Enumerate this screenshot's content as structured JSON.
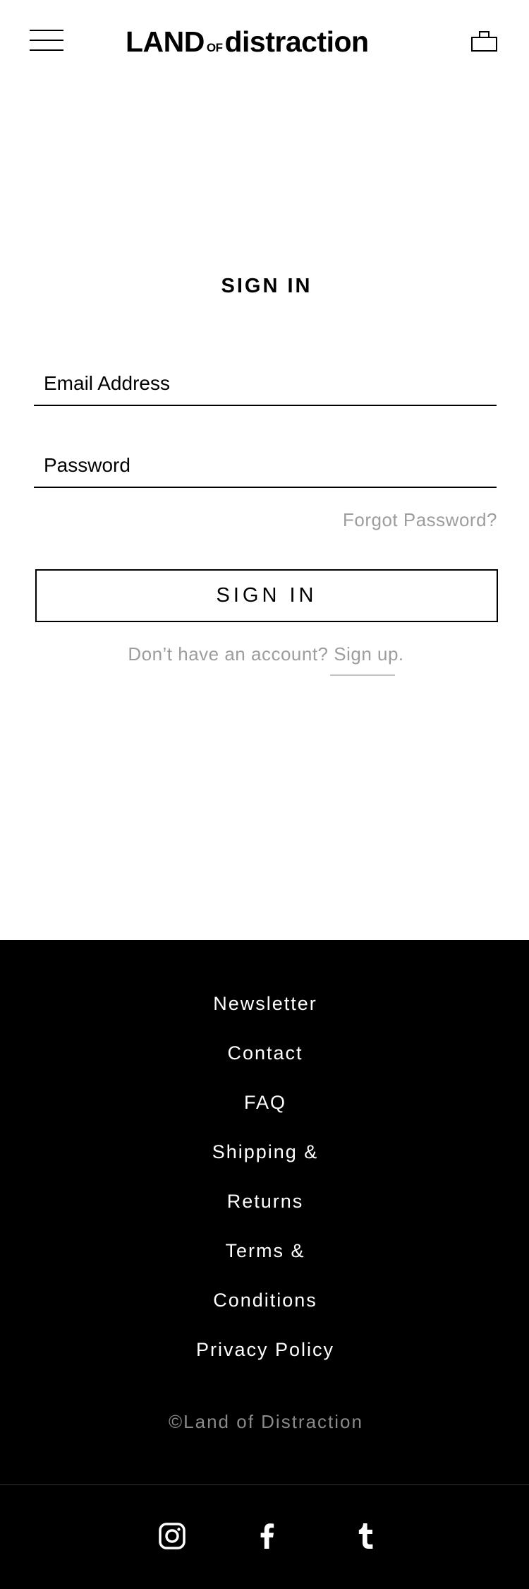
{
  "header": {
    "logo": {
      "part1": "LAND",
      "part2": "OF",
      "part3": "distraction"
    }
  },
  "signin": {
    "title": "SIGN IN",
    "email_placeholder": "Email Address",
    "password_placeholder": "Password",
    "forgot_label": "Forgot Password?",
    "button_label": "SIGN IN",
    "no_account_text": "Don’t have an account? ",
    "signup_label": "Sign up."
  },
  "footer": {
    "links": [
      "Newsletter",
      "Contact",
      "FAQ",
      "Shipping &",
      "Returns",
      "Terms &",
      "Conditions",
      "Privacy Policy"
    ],
    "copyright": "©Land of Distraction",
    "social": [
      "instagram-icon",
      "facebook-icon",
      "tumblr-icon"
    ]
  },
  "colors": {
    "text": "#000000",
    "muted": "#9d9d9d",
    "footer_bg": "#000000",
    "footer_text": "#ffffff",
    "copyright": "#8a8a8a"
  }
}
